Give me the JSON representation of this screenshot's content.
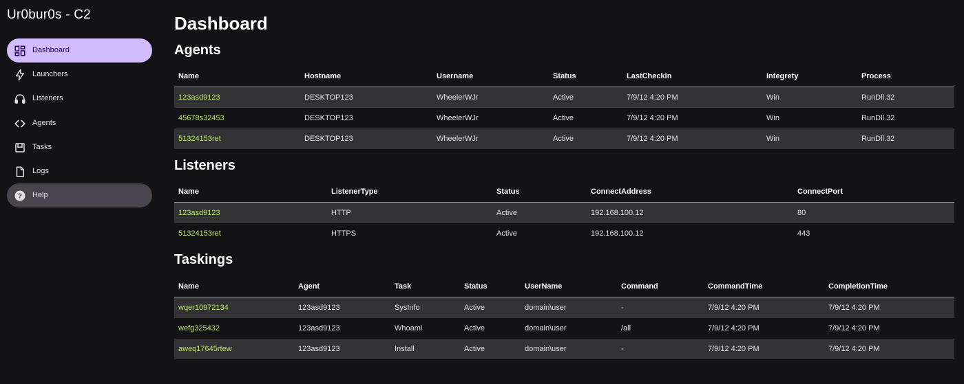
{
  "app": {
    "title": "Ur0bur0s - C2"
  },
  "sidebar": {
    "items": [
      {
        "label": "Dashboard",
        "icon": "dashboard-icon",
        "state": "active"
      },
      {
        "label": "Launchers",
        "icon": "bolt-icon",
        "state": "normal"
      },
      {
        "label": "Listeners",
        "icon": "headset-icon",
        "state": "normal"
      },
      {
        "label": "Agents",
        "icon": "code-icon",
        "state": "normal"
      },
      {
        "label": "Tasks",
        "icon": "inbox-icon",
        "state": "normal"
      },
      {
        "label": "Logs",
        "icon": "file-icon",
        "state": "normal"
      },
      {
        "label": "Help",
        "icon": "help-icon",
        "state": "hover"
      }
    ]
  },
  "main": {
    "page_title": "Dashboard",
    "agents": {
      "title": "Agents",
      "columns": [
        "Name",
        "Hostname",
        "Username",
        "Status",
        "LastCheckIn",
        "Integrety",
        "Process"
      ],
      "rows": [
        [
          "123asd9123",
          "DESKTOP123",
          "WheelerWJr",
          "Active",
          "7/9/12 4:20 PM",
          "Win",
          "RunDll.32"
        ],
        [
          "45678s32453",
          "DESKTOP123",
          "WheelerWJr",
          "Active",
          "7/9/12 4:20 PM",
          "Win",
          "RunDll.32"
        ],
        [
          "51324153ret",
          "DESKTOP123",
          "WheelerWJr",
          "Active",
          "7/9/12 4:20 PM",
          "Win",
          "RunDll.32"
        ]
      ]
    },
    "listeners": {
      "title": "Listeners",
      "columns": [
        "Name",
        "ListenerType",
        "Status",
        "ConnectAddress",
        "ConnectPort"
      ],
      "rows": [
        [
          "123asd9123",
          "HTTP",
          "Active",
          "192.168.100.12",
          "80"
        ],
        [
          "51324153ret",
          "HTTPS",
          "Active",
          "192.168.100.12",
          "443"
        ]
      ]
    },
    "taskings": {
      "title": "Taskings",
      "columns": [
        "Name",
        "Agent",
        "Task",
        "Status",
        "UserName",
        "Command",
        "CommandTime",
        "CompletionTime"
      ],
      "rows": [
        [
          "wqer10972134",
          "123asd9123",
          "SysInfo",
          "Active",
          "domain\\user",
          "-",
          "7/9/12 4:20 PM",
          "7/9/12 4:20 PM"
        ],
        [
          "wefg325432",
          "123asd9123",
          "Whoami",
          "Active",
          "domain\\user",
          "/all",
          "7/9/12 4:20 PM",
          "7/9/12 4:20 PM"
        ],
        [
          "aweq17645rtew",
          "123asd9123",
          "Install",
          "Active",
          "domain\\user",
          "-",
          "7/9/12 4:20 PM",
          "7/9/12 4:20 PM"
        ]
      ]
    }
  },
  "colors": {
    "background": "#131316",
    "active_nav": "#d0bcff",
    "hover_nav": "#49454f",
    "link": "#b8e86d",
    "row_stripe": "#333336"
  }
}
